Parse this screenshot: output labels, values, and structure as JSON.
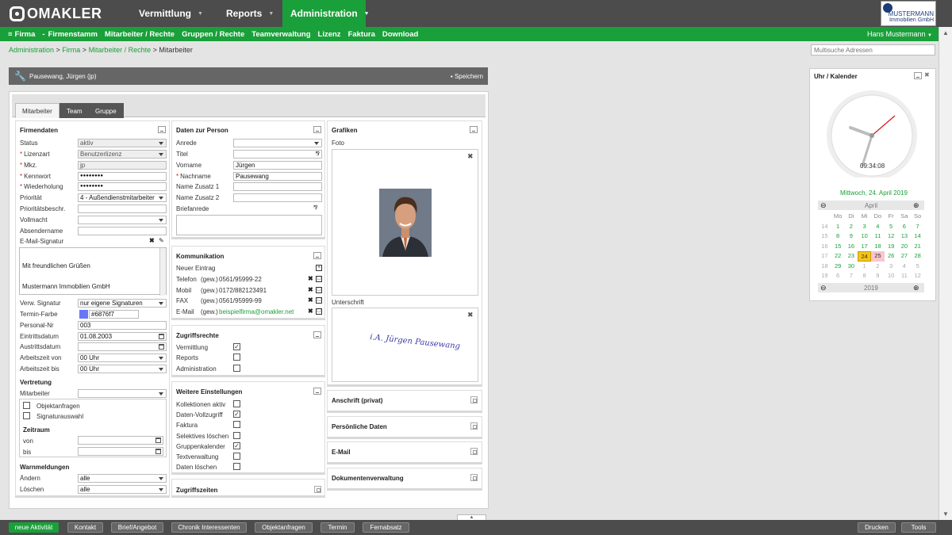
{
  "brand": {
    "logo": "OMAKLER",
    "customer_line1": "MUSTERMANN",
    "customer_line2": "Immobilien GmbH"
  },
  "topnav": {
    "vermittlung": "Vermittlung",
    "reports": "Reports",
    "administration": "Administration"
  },
  "subnav": {
    "items": [
      "Firma",
      "-",
      "Firmenstamm",
      "Mitarbeiter / Rechte",
      "Gruppen / Rechte",
      "Teamverwaltung",
      "Lizenz",
      "Faktura",
      "Download"
    ],
    "user": "Hans Mustermann"
  },
  "breadcrumb": {
    "links": [
      "Administration",
      "Firma",
      "Mitarbeiter / Rechte"
    ],
    "sep": " > ",
    "current": "Mitarbeiter"
  },
  "search": {
    "placeholder": "Multisuche Adressen"
  },
  "panel": {
    "title": "Pausewang, Jürgen (jp)",
    "save": "Speichern"
  },
  "tabs": [
    "Mitarbeiter",
    "Team",
    "Gruppe"
  ],
  "firmendaten": {
    "title": "Firmendaten",
    "status_label": "Status",
    "status": "aktiv",
    "lizenzart_label": "Lizenzart",
    "lizenzart": "Benutzerlizenz",
    "mkz_label": "Mkz.",
    "mkz": "jp",
    "kennwort_label": "Kennwort",
    "kennwort": "●●●●●●●●",
    "wiederholung_label": "Wiederholung",
    "wiederholung": "●●●●●●●●",
    "prioritaet_label": "Priorität",
    "prioritaet": "4 - Außendienstmitarbeiter",
    "prioritaetsbeschr_label": "Prioritätsbeschr.",
    "vollmacht_label": "Vollmacht",
    "absendername_label": "Absendername",
    "email_signatur_label": "E-Mail-Signatur",
    "signatur_line1": "Mit freundlichen Grüßen",
    "signatur_line2": "Mustermann Immobilien GmbH",
    "verw_signatur_label": "Verw. Signatur",
    "verw_signatur": "nur eigene Signaturen",
    "termin_farbe_label": "Termin-Farbe",
    "termin_farbe": "#6876f7",
    "personal_nr_label": "Personal-Nr",
    "personal_nr": "003",
    "eintritt_label": "Eintrittsdatum",
    "eintritt": "01.08.2003",
    "austritt_label": "Austrittsdatum",
    "az_von_label": "Arbeitszeit von",
    "az_von": "00 Uhr",
    "az_bis_label": "Arbeitszeit bis",
    "az_bis": "00 Uhr"
  },
  "vertretung": {
    "title": "Vertretung",
    "mitarbeiter_label": "Mitarbeiter",
    "opt1": "Objektanfragen",
    "opt2": "Signaturauswahl",
    "zeitraum": "Zeitraum",
    "von": "von",
    "bis": "bis"
  },
  "warnmeldungen": {
    "title": "Warnmeldungen",
    "aendern_label": "Ändern",
    "aendern": "alle",
    "loeschen_label": "Löschen",
    "loeschen": "alle"
  },
  "person": {
    "title": "Daten zur Person",
    "anrede": "Anrede",
    "titel": "Titel",
    "vorname_label": "Vorname",
    "vorname": "Jürgen",
    "nachname_label": "Nachname",
    "nachname": "Pausewang",
    "zusatz1": "Name Zusatz 1",
    "zusatz2": "Name Zusatz 2",
    "briefanrede": "Briefanrede"
  },
  "kommunikation": {
    "title": "Kommunikation",
    "neuer": "Neuer Eintrag",
    "rows": [
      {
        "type": "Telefon",
        "tag": "(gew.)",
        "value": "0561/95999-22"
      },
      {
        "type": "Mobil",
        "tag": "(gew.)",
        "value": "0172/882123491"
      },
      {
        "type": "FAX",
        "tag": "(gew.)",
        "value": "0561/95999-99"
      },
      {
        "type": "E-Mail",
        "tag": "(gew.)",
        "value": "beispielfirma@omakler.net"
      }
    ]
  },
  "zugriffsrechte": {
    "title": "Zugriffsrechte",
    "items": [
      {
        "label": "Vermittlung",
        "checked": true
      },
      {
        "label": "Reports",
        "checked": false
      },
      {
        "label": "Administration",
        "checked": false
      }
    ]
  },
  "weitere": {
    "title": "Weitere Einstellungen",
    "items": [
      {
        "label": "Kollektionen aktiv",
        "checked": false
      },
      {
        "label": "Daten-Vollzugriff",
        "checked": true
      },
      {
        "label": "Faktura",
        "checked": false
      },
      {
        "label": "Selektives löschen",
        "checked": false
      },
      {
        "label": "Gruppenkalender",
        "checked": true
      },
      {
        "label": "Textverwaltung",
        "checked": false
      },
      {
        "label": "Daten löschen",
        "checked": false
      }
    ]
  },
  "zugriffszeiten": {
    "title": "Zugriffszeiten"
  },
  "grafiken": {
    "title": "Grafiken",
    "foto": "Foto",
    "unterschrift": "Unterschrift",
    "signature_text": "i.A. Jürgen Pausewang"
  },
  "collapsed": [
    "Anschrift (privat)",
    "Persönliche Daten",
    "E-Mail",
    "Dokumentenverwaltung"
  ],
  "clock": {
    "title": "Uhr / Kalender",
    "time": "09:34:08",
    "date": "Mittwoch, 24. April 2019"
  },
  "calendar": {
    "month": "April",
    "year": "2019",
    "weekdays": [
      "Mo",
      "Di",
      "Mi",
      "Do",
      "Fr",
      "Sa",
      "So"
    ],
    "weeks": [
      {
        "kw": "14",
        "days": [
          "1",
          "2",
          "3",
          "4",
          "5",
          "6",
          "7"
        ]
      },
      {
        "kw": "15",
        "days": [
          "8",
          "9",
          "10",
          "11",
          "12",
          "13",
          "14"
        ]
      },
      {
        "kw": "16",
        "days": [
          "15",
          "16",
          "17",
          "18",
          "19",
          "20",
          "21"
        ]
      },
      {
        "kw": "17",
        "days": [
          "22",
          "23",
          "24",
          "25",
          "26",
          "27",
          "28"
        ]
      },
      {
        "kw": "18",
        "days": [
          "29",
          "30",
          "1",
          "2",
          "3",
          "4",
          "5"
        ]
      },
      {
        "kw": "19",
        "days": [
          "6",
          "7",
          "8",
          "9",
          "10",
          "11",
          "12"
        ]
      }
    ],
    "today": "24",
    "marked": "25"
  },
  "bottom": {
    "buttons": [
      "neue Aktivität",
      "Kontakt",
      "Brief/Angebot",
      "Chronik Interessenten",
      "Objektanfragen",
      "Termin",
      "Fernabsatz"
    ],
    "right": [
      "Drucken",
      "Tools"
    ]
  },
  "colors": {
    "green": "#1aa03a",
    "dark": "#4c4c4c",
    "termin": "#6876f7"
  }
}
